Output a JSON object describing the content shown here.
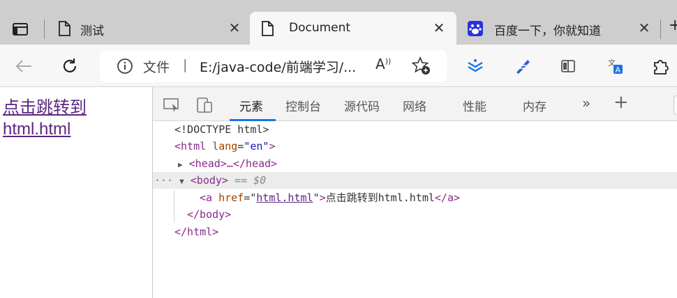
{
  "tabs": [
    {
      "label": "测试",
      "active": false
    },
    {
      "label": "Document",
      "active": true
    },
    {
      "label": "百度一下，你就知道",
      "active": false
    }
  ],
  "address": {
    "prefix": "文件",
    "url": "E:/java-code/前端学习/..."
  },
  "page": {
    "link_text": "点击跳转到html.html"
  },
  "devtools": {
    "tabs": [
      "元素",
      "控制台",
      "源代码",
      "网络",
      "性能",
      "内存"
    ],
    "active_tab": "元素",
    "dom": {
      "doctype": "<!DOCTYPE html>",
      "html_open": "<html",
      "html_lang_attr": "lang",
      "html_lang_val": "\"en\"",
      "head": "<head>…</head>",
      "body_open": "<body>",
      "selected_marker": "== $0",
      "a_open": "<a",
      "a_href_attr": "href",
      "a_href_val": "html.html",
      "a_text": "点击跳转到html.html",
      "a_close": "</a>",
      "body_close": "</body>",
      "html_close": "</html>"
    }
  },
  "colors": {
    "link": "#5b2580",
    "accent": "#1a73e8"
  }
}
